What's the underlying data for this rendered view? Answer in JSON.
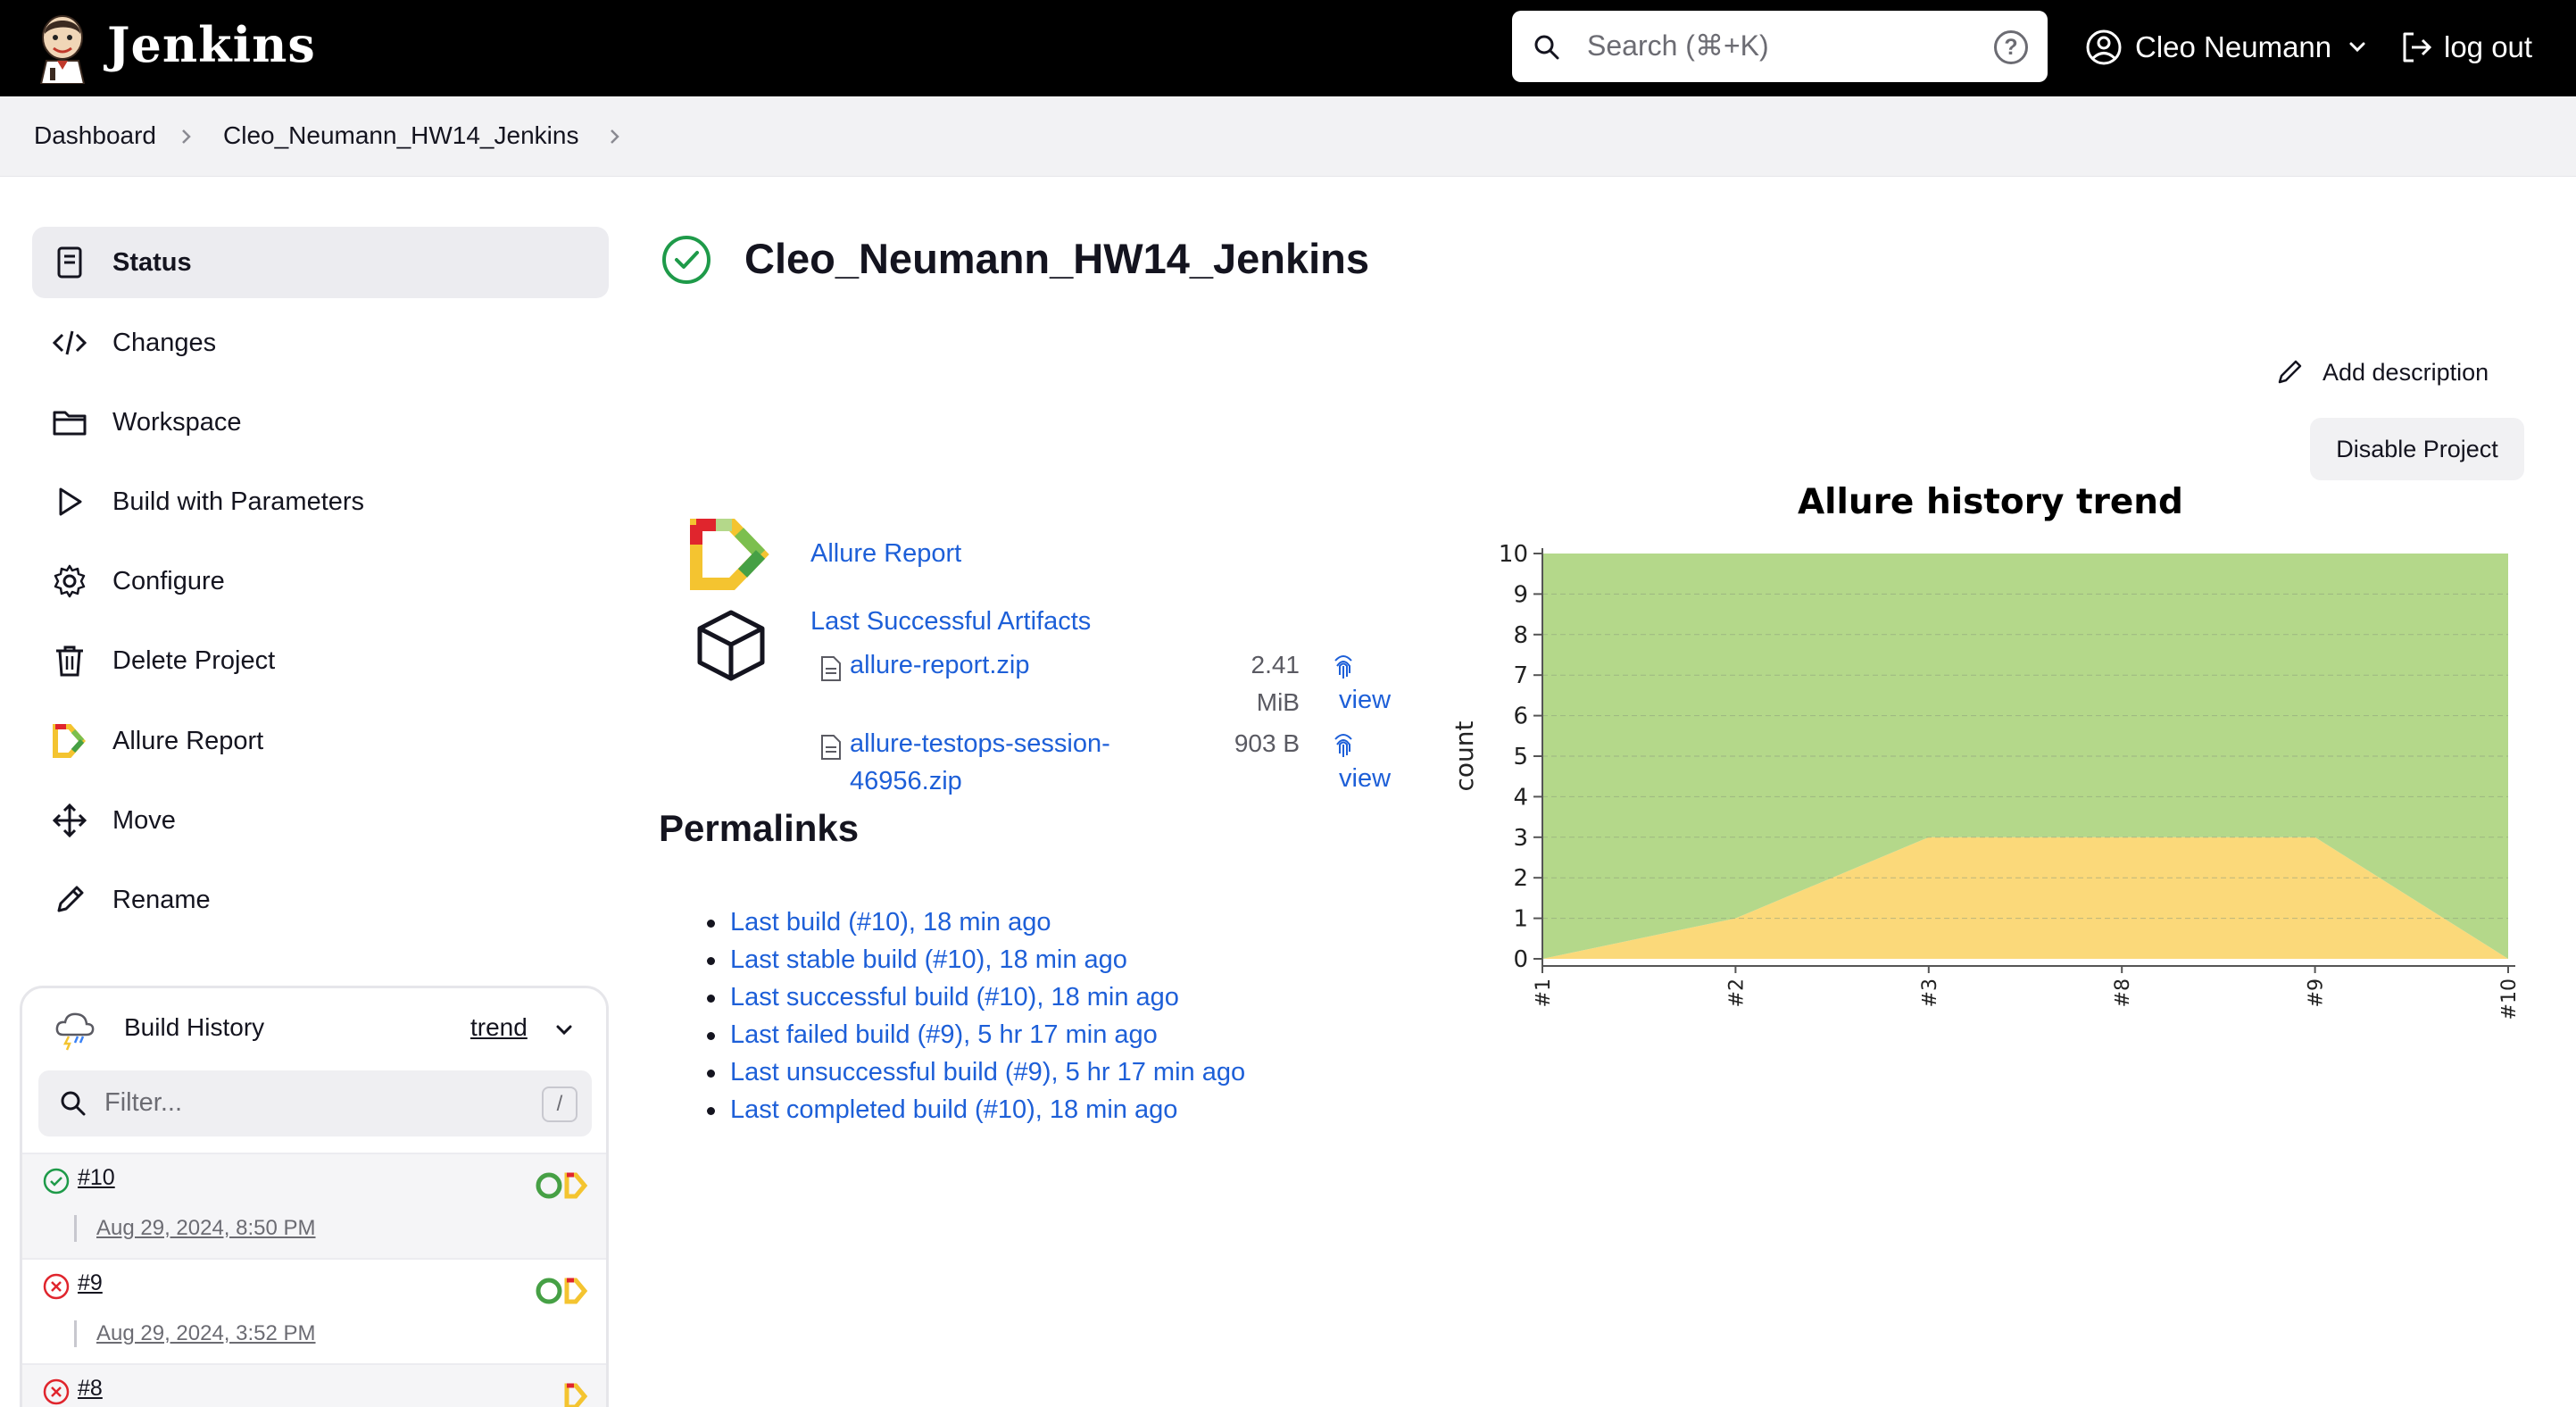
{
  "header": {
    "brand": "Jenkins",
    "search_placeholder": "Search (⌘+K)",
    "help_glyph": "?",
    "user_name": "Cleo Neumann",
    "logout_label": "log out"
  },
  "breadcrumb": [
    "Dashboard",
    "Cleo_Neumann_HW14_Jenkins"
  ],
  "sidebar": {
    "items": [
      {
        "label": "Status",
        "icon": "status-icon"
      },
      {
        "label": "Changes",
        "icon": "code-icon"
      },
      {
        "label": "Workspace",
        "icon": "folder-icon"
      },
      {
        "label": "Build with Parameters",
        "icon": "play-icon"
      },
      {
        "label": "Configure",
        "icon": "gear-icon"
      },
      {
        "label": "Delete Project",
        "icon": "trash-icon"
      },
      {
        "label": "Allure Report",
        "icon": "allure-icon"
      },
      {
        "label": "Move",
        "icon": "move-icon"
      },
      {
        "label": "Rename",
        "icon": "pencil-icon"
      }
    ]
  },
  "build_history": {
    "title": "Build History",
    "trend_label": "trend",
    "filter_placeholder": "Filter...",
    "filter_shortcut": "/",
    "builds": [
      {
        "number": "#10",
        "date": "Aug 29, 2024, 8:50 PM",
        "status": "success"
      },
      {
        "number": "#9",
        "date": "Aug 29, 2024, 3:52 PM",
        "status": "failed"
      },
      {
        "number": "#8",
        "date": "",
        "status": "failed"
      }
    ]
  },
  "main": {
    "title": "Cleo_Neumann_HW14_Jenkins",
    "add_description": "Add description",
    "disable_project": "Disable Project",
    "allure_report_link": "Allure Report",
    "last_successful_artifacts": "Last Successful Artifacts",
    "artifacts": [
      {
        "name_lines": [
          "allure-report.zip"
        ],
        "size_lines": [
          "2.41",
          "MiB"
        ],
        "view": "view"
      },
      {
        "name_lines": [
          "allure-testops-session-",
          "46956.zip"
        ],
        "size_lines": [
          "903 B"
        ],
        "view": "view"
      }
    ],
    "permalinks_heading": "Permalinks",
    "permalinks": [
      "Last build (#10), 18 min ago",
      "Last stable build (#10), 18 min ago",
      "Last successful build (#10), 18 min ago",
      "Last failed build (#9), 5 hr 17 min ago",
      "Last unsuccessful build (#9), 5 hr 17 min ago",
      "Last completed build (#10), 18 min ago"
    ]
  },
  "chart_data": {
    "type": "area",
    "title": "Allure history trend",
    "xlabel": "",
    "ylabel": "count",
    "x": [
      "#1",
      "#2",
      "#3",
      "#8",
      "#9",
      "#10"
    ],
    "ylim": [
      0,
      10
    ],
    "yticks": [
      0,
      1,
      2,
      3,
      4,
      5,
      6,
      7,
      8,
      9,
      10
    ],
    "grid": true,
    "stacked": true,
    "series": [
      {
        "values": [
          0,
          1,
          3,
          3,
          3,
          0
        ],
        "color": "#fbd97a"
      },
      {
        "values": [
          10,
          9,
          7,
          7,
          7,
          10
        ],
        "color": "#b4d88a"
      }
    ]
  },
  "colors": {
    "link": "#1d5fd8",
    "success": "#1e9a49",
    "failed": "#e0252d",
    "header_bg": "#000000"
  }
}
